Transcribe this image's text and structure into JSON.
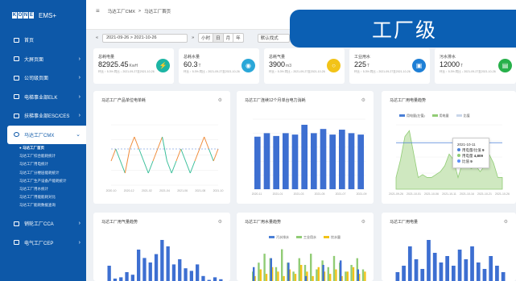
{
  "sidebar": {
    "brand": {
      "letters": [
        "K",
        "O",
        "N",
        "E"
      ],
      "app": "EMS+"
    },
    "items": [
      {
        "label": "首页",
        "icon": "home-icon",
        "arrow": ""
      },
      {
        "label": "大屏页面",
        "icon": "monitor-icon",
        "arrow": "›"
      },
      {
        "label": "公司级页面",
        "icon": "building-icon",
        "arrow": "›"
      },
      {
        "label": "电梯事业部ELK",
        "icon": "elevator-icon",
        "arrow": "›"
      },
      {
        "label": "扶梯事业部ESC/CES",
        "icon": "escalator-icon",
        "arrow": "›"
      }
    ],
    "active": {
      "label": "马达工厂CMX",
      "icon": "factory-icon",
      "arrow": "⌄"
    },
    "sub": [
      "● 马达工厂首页",
      "马达工厂综合能耗统计",
      "马达工厂用电统计",
      "马达工厂分楼层能耗统计",
      "马达工厂生产设备产能耗统计",
      "马达工厂用水统计",
      "马达工厂用能能耗对比",
      "马达工厂能耗数据查询"
    ],
    "bottom": [
      {
        "label": "销轮工厂CCA",
        "icon": "gear-icon",
        "arrow": "›"
      },
      {
        "label": "电气工厂CEP",
        "icon": "plug-icon",
        "arrow": "›"
      }
    ]
  },
  "topbar": {
    "menu_icon": "≡",
    "crumb1": "马达工厂CMX",
    "sep": ">",
    "crumb2": "马达工厂首页"
  },
  "banner": "工厂级",
  "filter": {
    "prev": "«",
    "range": "2021-09-26 > 2021-10-26",
    "next": "»",
    "seg": [
      "小时",
      "日",
      "月",
      "年"
    ],
    "seg_active": 1,
    "mode": "默认找式"
  },
  "kpis": [
    {
      "title": "总耗电量",
      "value": "82925.45",
      "unit": "KwH",
      "sub": "环比 ↑ 5.3%   同比 ↓ 2021-09-27至2021-10-26",
      "color": "#1db5a4",
      "icon": "lightning-icon",
      "glyph": "⚡"
    },
    {
      "title": "总耗水量",
      "value": "60.3",
      "unit": "T",
      "sub": "环比 ↑ 5.3%   同比 ↓ 2021-09-27至2021-10-26",
      "color": "#2aa7d8",
      "icon": "water-drop-icon",
      "glyph": "💧"
    },
    {
      "title": "总耗气量",
      "value": "3900",
      "unit": "m3",
      "sub": "环比 ↑ 5.3%   同比 ↓ 2021-09-27至2021-10-26",
      "color": "#f2c318",
      "icon": "gas-icon",
      "glyph": "○"
    },
    {
      "title": "工业用水",
      "value": "225",
      "unit": "T",
      "sub": "环比 ↑ 5.3%   同比 ↓ 2021-09-27至2021-10-26",
      "color": "#1e7fd6",
      "icon": "tap-icon",
      "glyph": "▣"
    },
    {
      "title": "污水排水",
      "value": "12000",
      "unit": "T",
      "sub": "环比 ↑ 5.3%   同比 ↓ 2021-09-27至2021-10-26",
      "color": "#27b04a",
      "icon": "drain-icon",
      "glyph": "▤"
    }
  ],
  "cards": {
    "c1": {
      "title": "马达工厂产品单位电单耗",
      "gear": "⚙"
    },
    "c2": {
      "title": "马达工厂连续12个月单台电力消耗",
      "gear": "⚙"
    },
    "c3": {
      "title": "马达工厂用电量趋势",
      "gear": "⚙",
      "legend": [
        "用电量(左值)",
        "用电量",
        "比值"
      ],
      "tip": {
        "date": "2021-10-11",
        "rows": [
          {
            "label": "用电量/比值",
            "value": "9",
            "color": "#4a7fd6"
          },
          {
            "label": "用电量",
            "value": "4,809",
            "color": "#91cc75"
          },
          {
            "label": "比值",
            "value": "9",
            "color": "#5b8ff9"
          }
        ]
      }
    },
    "c4": {
      "title": "马达工厂用气量趋势",
      "gear": "⚙"
    },
    "c5": {
      "title": "马达工厂用水量趋势",
      "gear": "⚙",
      "legend": [
        "污水排水",
        "工业用水",
        "饮水量"
      ]
    },
    "c6": {
      "title": "马达工厂用电量",
      "gear": "⚙"
    }
  },
  "chart_data": [
    {
      "type": "line",
      "title": "马达工厂产品单位电单耗",
      "x": [
        "2020-10",
        "2020-12",
        "2021-02",
        "2021-04",
        "2021-06",
        "2021-08",
        "2021-10"
      ],
      "series": [
        {
          "values": [
            5,
            6,
            5,
            4,
            6,
            7,
            6,
            5,
            4,
            5,
            6,
            7,
            5,
            4,
            5,
            6,
            5,
            4,
            5,
            6,
            7,
            6,
            5,
            6
          ]
        }
      ]
    },
    {
      "type": "bar",
      "title": "马达工厂连续12个月单台电力消耗",
      "x": [
        "2020-11",
        "2020-12",
        "2021-01",
        "2021-02",
        "2021-03",
        "2021-04",
        "2021-05",
        "2021-06",
        "2021-07",
        "2021-08",
        "2021-09",
        "2021-10"
      ],
      "values": [
        75,
        80,
        76,
        80,
        78,
        92,
        80,
        86,
        78,
        85,
        80,
        78
      ]
    },
    {
      "type": "line",
      "title": "马达工厂用电量趋势",
      "x": [
        "2021-09-26",
        "2021-10-01",
        "2021-10-06",
        "2021-10-11",
        "2021-10-16",
        "2021-10-21",
        "2021-10-26"
      ],
      "series": [
        {
          "name": "用电量(左值)",
          "values": [
            4,
            10,
            18,
            20,
            12,
            4,
            5,
            4,
            4,
            5,
            6,
            8,
            12,
            10,
            4,
            9,
            8,
            7,
            8,
            6,
            8,
            12,
            9,
            4,
            4
          ]
        },
        {
          "name": "比值",
          "values": [
            9,
            9,
            9,
            9,
            9,
            9,
            9,
            9,
            9,
            9,
            9,
            9,
            9,
            9,
            9,
            9,
            9,
            9,
            9,
            9,
            9,
            9,
            9,
            9,
            9
          ]
        }
      ]
    },
    {
      "type": "bar",
      "title": "马达工厂用气量趋势",
      "values": [
        30,
        10,
        12,
        20,
        16,
        55,
        42,
        35,
        48,
        70,
        60,
        32,
        40,
        26,
        22,
        32,
        14,
        8,
        12,
        9
      ]
    },
    {
      "type": "bar",
      "title": "马达工厂用水量趋势",
      "series": [
        {
          "name": "污水排水",
          "values": [
            40,
            60,
            50,
            20,
            45,
            55,
            35
          ]
        },
        {
          "name": "工业用水",
          "values": [
            30,
            50,
            70,
            60,
            40,
            80,
            50,
            30,
            60,
            45,
            70,
            35,
            55,
            40,
            65,
            50,
            30,
            45,
            60,
            35
          ]
        },
        {
          "name": "饮水量",
          "values": [
            20,
            35,
            25,
            40,
            30,
            20,
            35,
            25,
            45,
            30,
            20,
            40,
            30,
            25,
            35,
            20,
            30,
            40,
            25,
            30
          ]
        }
      ]
    },
    {
      "type": "bar",
      "title": "马达工厂用电量",
      "values": [
        20,
        30,
        60,
        40,
        25,
        70,
        50,
        35,
        45,
        30,
        55,
        40,
        60,
        35,
        25,
        45,
        30,
        20
      ]
    }
  ]
}
